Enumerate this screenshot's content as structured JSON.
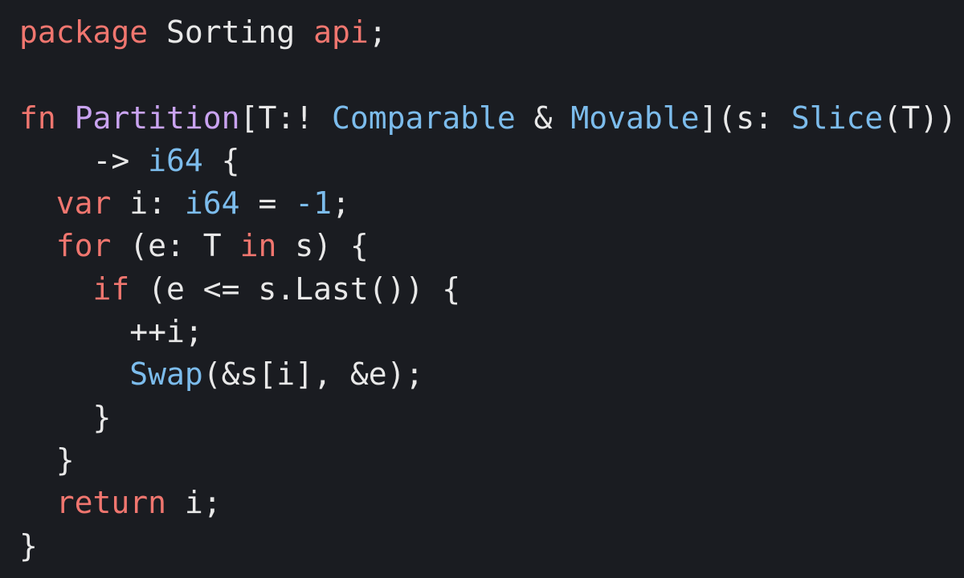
{
  "colors": {
    "background": "#1a1c21",
    "keyword": "#f0766f",
    "type": "#7cbcec",
    "function": "#c9a3f0",
    "text": "#e8e8e8"
  },
  "code_lines": [
    [
      {
        "t": "package",
        "k": "keyword"
      },
      {
        "t": " Sorting ",
        "k": "text"
      },
      {
        "t": "api",
        "k": "keyword"
      },
      {
        "t": ";",
        "k": "text"
      }
    ],
    [],
    [
      {
        "t": "fn",
        "k": "keyword"
      },
      {
        "t": " ",
        "k": "text"
      },
      {
        "t": "Partition",
        "k": "function"
      },
      {
        "t": "[T:! ",
        "k": "text"
      },
      {
        "t": "Comparable",
        "k": "type"
      },
      {
        "t": " & ",
        "k": "text"
      },
      {
        "t": "Movable",
        "k": "type"
      },
      {
        "t": "](s: ",
        "k": "text"
      },
      {
        "t": "Slice",
        "k": "type"
      },
      {
        "t": "(T))",
        "k": "text"
      }
    ],
    [
      {
        "t": "    -> ",
        "k": "text"
      },
      {
        "t": "i64",
        "k": "type"
      },
      {
        "t": " {",
        "k": "text"
      }
    ],
    [
      {
        "t": "  ",
        "k": "text"
      },
      {
        "t": "var",
        "k": "keyword"
      },
      {
        "t": " i: ",
        "k": "text"
      },
      {
        "t": "i64",
        "k": "type"
      },
      {
        "t": " = ",
        "k": "text"
      },
      {
        "t": "-1",
        "k": "type"
      },
      {
        "t": ";",
        "k": "text"
      }
    ],
    [
      {
        "t": "  ",
        "k": "text"
      },
      {
        "t": "for",
        "k": "keyword"
      },
      {
        "t": " (e: T ",
        "k": "text"
      },
      {
        "t": "in",
        "k": "keyword"
      },
      {
        "t": " s) {",
        "k": "text"
      }
    ],
    [
      {
        "t": "    ",
        "k": "text"
      },
      {
        "t": "if",
        "k": "keyword"
      },
      {
        "t": " (e <= s.Last()) {",
        "k": "text"
      }
    ],
    [
      {
        "t": "      ++i;",
        "k": "text"
      }
    ],
    [
      {
        "t": "      ",
        "k": "text"
      },
      {
        "t": "Swap",
        "k": "type"
      },
      {
        "t": "(&s[i], &e);",
        "k": "text"
      }
    ],
    [
      {
        "t": "    }",
        "k": "text"
      }
    ],
    [
      {
        "t": "  }",
        "k": "text"
      }
    ],
    [
      {
        "t": "  ",
        "k": "text"
      },
      {
        "t": "return",
        "k": "keyword"
      },
      {
        "t": " i;",
        "k": "text"
      }
    ],
    [
      {
        "t": "}",
        "k": "text"
      }
    ]
  ]
}
